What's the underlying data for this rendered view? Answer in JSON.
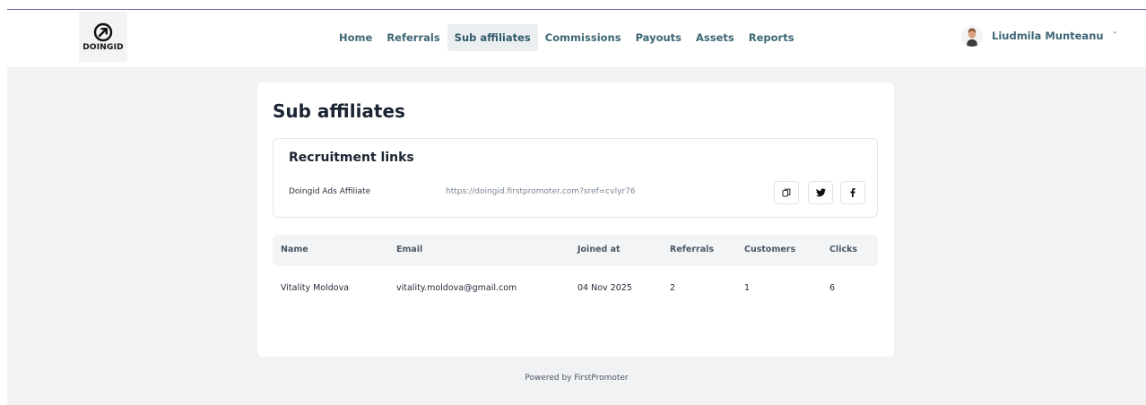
{
  "brand": {
    "logo_text": "DOINGID"
  },
  "nav": {
    "items": [
      {
        "label": "Home",
        "active": false
      },
      {
        "label": "Referrals",
        "active": false
      },
      {
        "label": "Sub affiliates",
        "active": true
      },
      {
        "label": "Commissions",
        "active": false
      },
      {
        "label": "Payouts",
        "active": false
      },
      {
        "label": "Assets",
        "active": false
      },
      {
        "label": "Reports",
        "active": false
      }
    ]
  },
  "user": {
    "name": "Liudmila Munteanu",
    "chevron": "˅"
  },
  "page": {
    "title": "Sub affiliates"
  },
  "recruitment": {
    "title": "Recruitment links",
    "links": [
      {
        "name": "Doingid Ads Affiliate",
        "url": "https://doingid.firstpromoter.com?sref=cvlyr76"
      }
    ],
    "actions": [
      "copy-icon",
      "twitter-icon",
      "facebook-icon"
    ]
  },
  "table": {
    "columns": [
      "Name",
      "Email",
      "Joined at",
      "Referrals",
      "Customers",
      "Clicks"
    ],
    "rows": [
      {
        "name": "Vitality Moldova",
        "email": "vitality.moldova@gmail.com",
        "joined_at": "04 Nov 2025",
        "referrals": "2",
        "customers": "1",
        "clicks": "6"
      }
    ]
  },
  "footer": {
    "text": "Powered by FirstPromoter"
  },
  "colors": {
    "nav_text": "#3d6675",
    "background": "#f1f2f4",
    "accent_border": "#7a5ea8"
  }
}
